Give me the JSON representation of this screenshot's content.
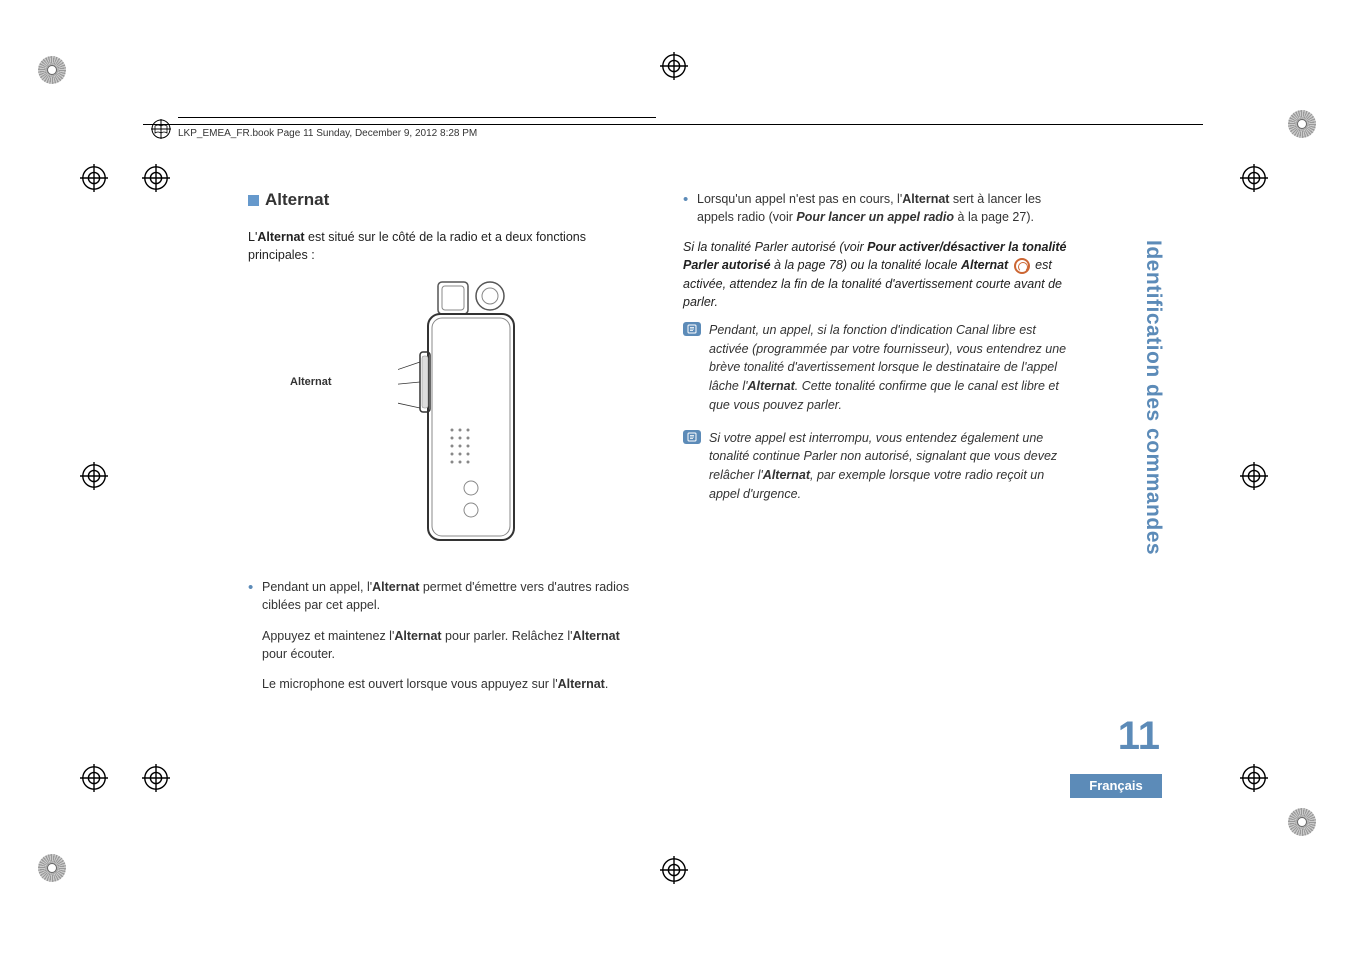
{
  "header": {
    "text": "LKP_EMEA_FR.book  Page 11  Sunday, December 9, 2012  8:28 PM"
  },
  "section": {
    "title": "Alternat"
  },
  "left_column": {
    "intro_prefix": "L'",
    "intro_bold": "Alternat",
    "intro_suffix": " est situé sur le côté de la radio et a deux fonctions principales :",
    "figure_label": "Alternat",
    "bullet1_prefix": "Pendant un appel, l'",
    "bullet1_bold": "Alternat",
    "bullet1_suffix": " permet d'émettre vers d'autres radios ciblées par cet appel.",
    "indent1_prefix": "Appuyez et maintenez l'",
    "indent1_bold1": "Alternat",
    "indent1_mid": " pour parler. Relâchez l'",
    "indent1_bold2": "Alternat",
    "indent1_suffix": " pour écouter.",
    "indent2_prefix": "Le microphone est ouvert lorsque vous appuyez sur l'",
    "indent2_bold": "Alternat",
    "indent2_suffix": "."
  },
  "right_column": {
    "bullet1_prefix": "Lorsqu'un appel n'est pas en cours, l'",
    "bullet1_bold": "Alternat",
    "bullet1_mid": " sert à lancer les appels radio (voir ",
    "bullet1_ref": "Pour lancer un appel radio",
    "bullet1_suffix": " à la page 27).",
    "italic_para_prefix": "Si la tonalité Parler autorisé (voir ",
    "italic_para_ref1": "Pour activer/désactiver la tonalité Parler autorisé",
    "italic_para_mid1": " à la page 78) ou la tonalité locale ",
    "italic_para_bold1": "Alternat",
    "italic_para_mid2": " est activée, attendez la fin de la tonalité d'avertissement courte avant de parler.",
    "note1_prefix": "Pendant, un appel, si la fonction d'indication Canal libre est activée (programmée par votre fournisseur), vous entendrez une brève tonalité d'avertissement lorsque le destinataire de l'appel lâche l'",
    "note1_bold": "Alternat",
    "note1_suffix": ". Cette tonalité confirme que le canal est libre et que vous pouvez parler.",
    "note2_prefix": "Si votre appel est interrompu, vous entendez également une tonalité continue Parler non autorisé, signalant que vous devez relâcher l'",
    "note2_bold": "Alternat",
    "note2_suffix": ", par exemple lorsque votre radio reçoit un appel d'urgence."
  },
  "sidebar": "Identification des commandes",
  "page_number": "11",
  "language": "Français"
}
